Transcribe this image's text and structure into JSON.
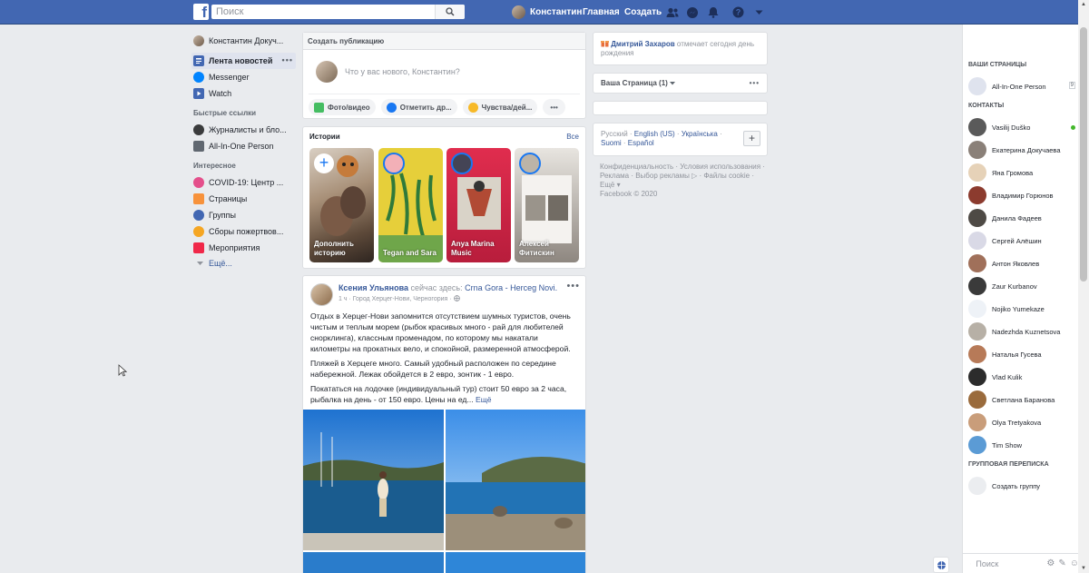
{
  "topbar": {
    "logo": "f",
    "search_placeholder": "Поиск",
    "user_name": "Константин",
    "home_label": "Главная",
    "create_label": "Создать"
  },
  "leftnav": {
    "profile_name": "Константин Докуч...",
    "items": [
      {
        "label": "Лента новостей",
        "icon": "news-feed-icon"
      },
      {
        "label": "Messenger",
        "icon": "messenger-icon"
      },
      {
        "label": "Watch",
        "icon": "watch-icon"
      }
    ],
    "shortcuts_title": "Быстрые ссылки",
    "shortcuts": [
      {
        "label": "Журналисты и бло..."
      },
      {
        "label": "All-In-One Person"
      }
    ],
    "explore_title": "Интересное",
    "explore": [
      {
        "label": "COVID-19: Центр ..."
      },
      {
        "label": "Страницы"
      },
      {
        "label": "Группы"
      },
      {
        "label": "Сборы пожертвов..."
      },
      {
        "label": "Мероприятия"
      }
    ],
    "more_label": "Ещё..."
  },
  "composer": {
    "header": "Создать публикацию",
    "placeholder": "Что у вас нового, Константин?",
    "actions": [
      "Фото/видео",
      "Отметить др...",
      "Чувства/дей..."
    ]
  },
  "stories": {
    "title": "Истории",
    "see_all": "Все",
    "items": [
      {
        "label": "Дополнить историю"
      },
      {
        "label": "Tegan and Sara"
      },
      {
        "label": "Anya Marina Music"
      },
      {
        "label": "Алексей Фитискин"
      }
    ]
  },
  "post": {
    "author": "Ксения Ульянова",
    "action": "сейчас здесь:",
    "place": "Crna Gora - Herceg Novi.",
    "meta": "1 ч · Город Херцег-Нови, Черногория ·",
    "paragraphs": [
      "Отдых в Херцег-Нови запомнится отсутствием шумных туристов, очень чистым и теплым морем (рыбок красивых много - рай для любителей снорклинга), классным променадом, по которому мы накатали километры на прокатных вело, и спокойной, размеренной атмосферой.",
      "Пляжей в Херцеге много. Самый удобный расположен по середине набережной. Лежак обойдется в 2 евро, зонтик - 1 евро.",
      "Покататься на лодочке (индивидуальный тур) стоит 50 евро за 2 часа, рыбалка на день - от 150 евро. Цены на ед..."
    ],
    "more_label": "Ещё"
  },
  "right": {
    "birthday_name": "Дмитрий Захаров",
    "birthday_text": "отмечает сегодня день рождения",
    "pages_label": "Ваша Страница (1)",
    "langs_current": "Русский",
    "langs": [
      "English (US)",
      "Українська",
      "Suomi",
      "Español"
    ],
    "footer": "Конфиденциальность · Условия использования · Реклама · Выбор рекламы ▷ · Файлы cookie · Ещё ▾",
    "copyright": "Facebook © 2020"
  },
  "chat": {
    "pages_title": "ВАШИ СТРАНИЦЫ",
    "page_name": "All-In-One Person",
    "page_badge": "9",
    "contacts_title": "КОНТАКТЫ",
    "contacts": [
      {
        "name": "Vasilij Duško",
        "online": true
      },
      {
        "name": "Екатерина Докучаева",
        "online": false
      },
      {
        "name": "Яна Громова",
        "online": false
      },
      {
        "name": "Владимир Горюнов",
        "online": false
      },
      {
        "name": "Данила Фадеев",
        "online": false
      },
      {
        "name": "Сергей Алёшин",
        "online": false
      },
      {
        "name": "Антон Яковлев",
        "online": false
      },
      {
        "name": "Zaur Kurbanov",
        "online": false
      },
      {
        "name": "Nojiko Yumekaze",
        "online": false
      },
      {
        "name": "Nadezhda Kuznetsova",
        "online": false
      },
      {
        "name": "Наталья Гусева",
        "online": false
      },
      {
        "name": "Vlad Kulik",
        "online": false
      },
      {
        "name": "Светлана Баранова",
        "online": false
      },
      {
        "name": "Olya Tretyakova",
        "online": false
      },
      {
        "name": "Tim Show",
        "online": false
      }
    ],
    "group_title": "ГРУППОВАЯ ПЕРЕПИСКА",
    "create_group": "Создать группу",
    "search_placeholder": "Поиск"
  },
  "colors": {
    "brand": "#4267b2",
    "link": "#365899",
    "background": "#e9ebee",
    "online": "#42b72a"
  }
}
